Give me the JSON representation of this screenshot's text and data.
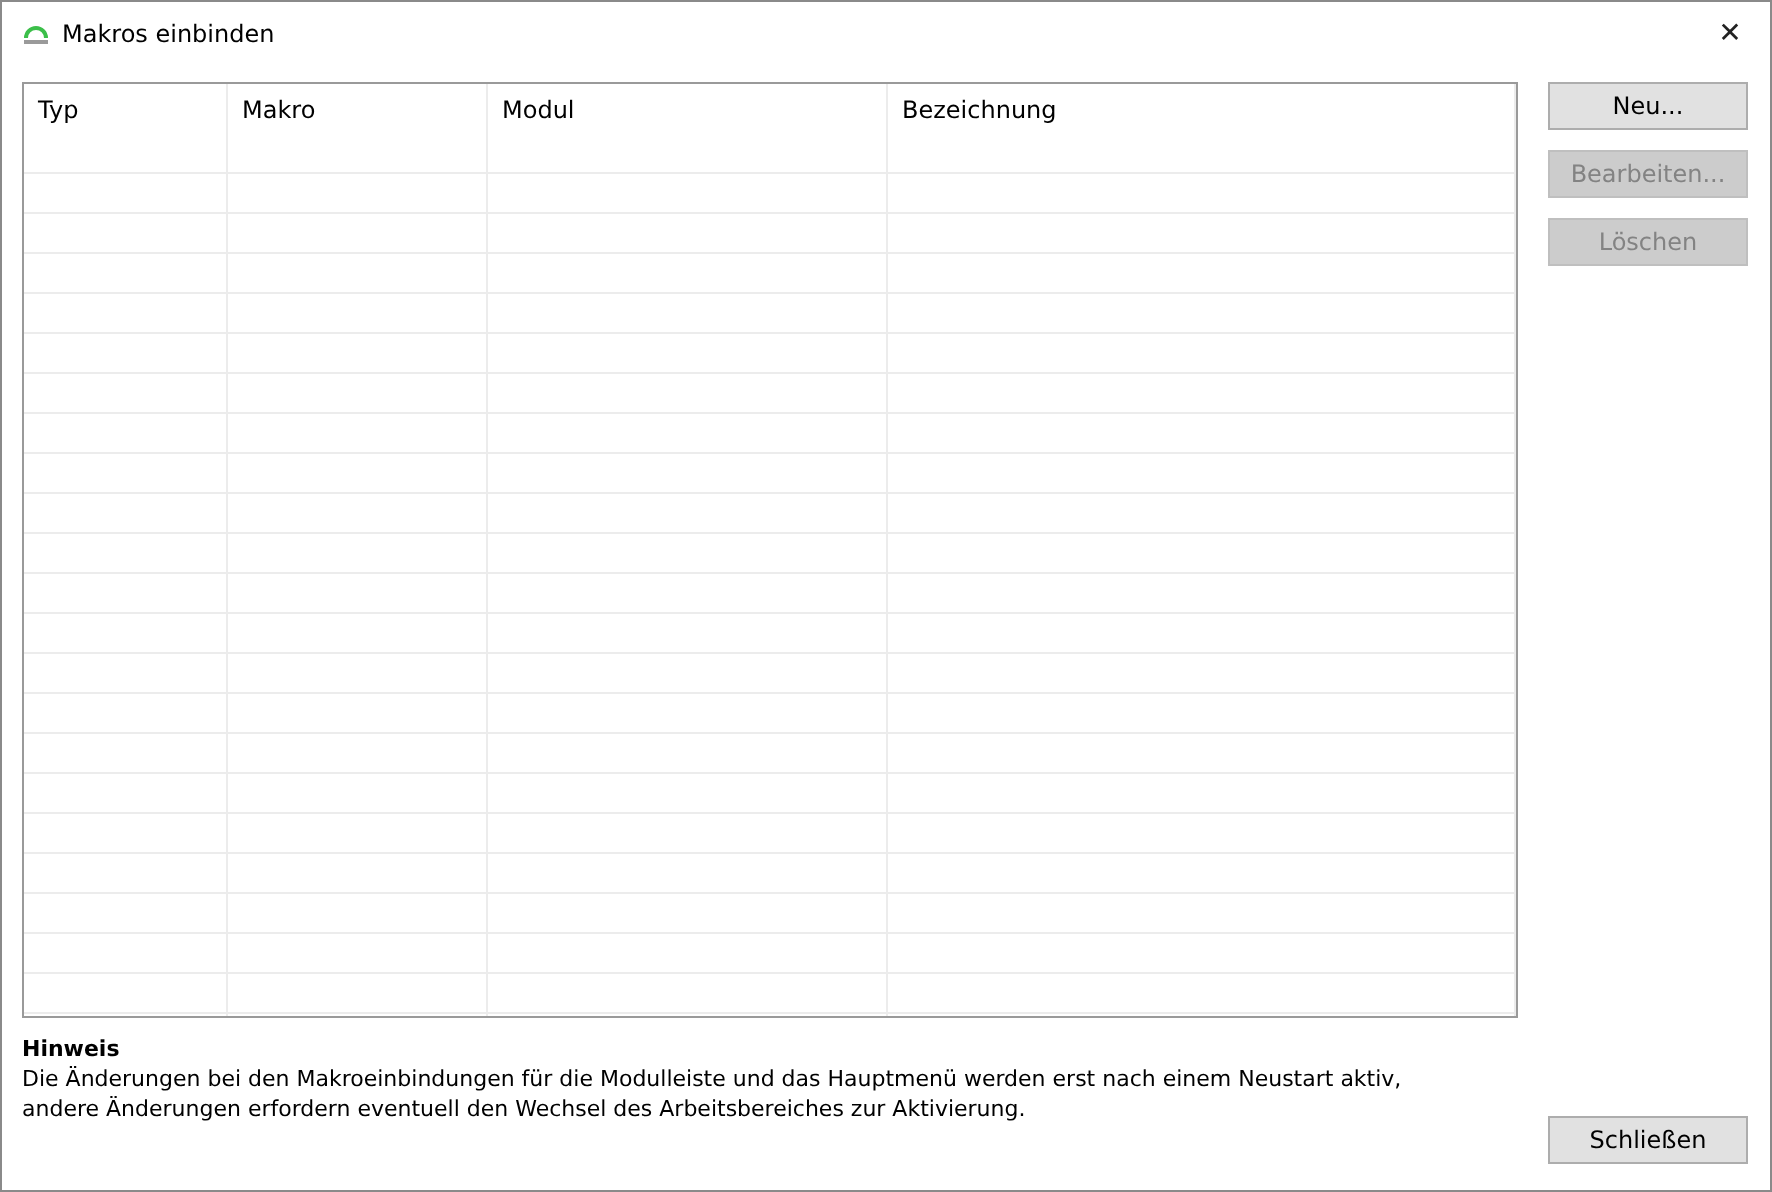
{
  "window": {
    "title": "Makros einbinden",
    "close": "✕"
  },
  "table": {
    "columns": [
      "Typ",
      "Makro",
      "Modul",
      "Bezeichnung"
    ]
  },
  "buttons": [
    {
      "label": "Neu...",
      "disabled": false
    },
    {
      "label": "Bearbeiten...",
      "disabled": true
    },
    {
      "label": "Löschen",
      "disabled": true
    }
  ],
  "hint": {
    "title": "Hinweis",
    "lines": [
      "Die Änderungen bei den Makroeinbindungen für die Modulleiste und das Hauptmenü werden erst nach einem Neustart aktiv,",
      "andere Änderungen erfordern eventuell den Wechsel des Arbeitsbereiches zur Aktivierung."
    ]
  },
  "close_button": {
    "label": "Schließen",
    "disabled": false
  }
}
